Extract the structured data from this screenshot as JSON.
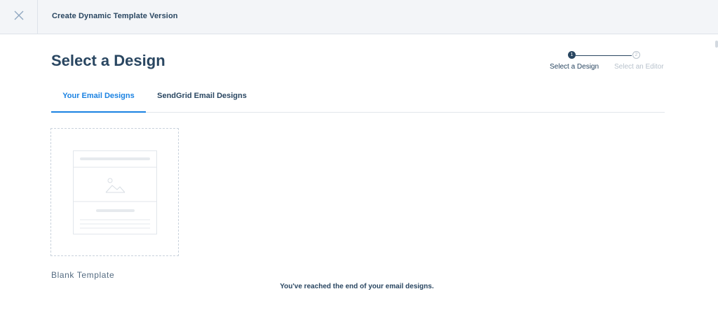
{
  "header": {
    "title": "Create Dynamic Template Version",
    "close_icon": "close-icon"
  },
  "page": {
    "title": "Select a Design"
  },
  "stepper": {
    "steps": [
      {
        "number": "1",
        "label": "Select a Design",
        "state": "active"
      },
      {
        "number": "2",
        "label": "Select an Editor",
        "state": "inactive"
      }
    ]
  },
  "tabs": [
    {
      "label": "Your Email Designs",
      "active": true
    },
    {
      "label": "SendGrid Email Designs",
      "active": false
    }
  ],
  "designs": [
    {
      "label": "Blank Template",
      "thumbnail_icon": "blank-template-thumbnail-icon"
    }
  ],
  "end_message": "You've reached the end of your email designs.",
  "colors": {
    "primary_text": "#294661",
    "accent": "#1a82e2",
    "muted": "#b8c2cc",
    "topbar_bg": "#f3f5f8"
  }
}
